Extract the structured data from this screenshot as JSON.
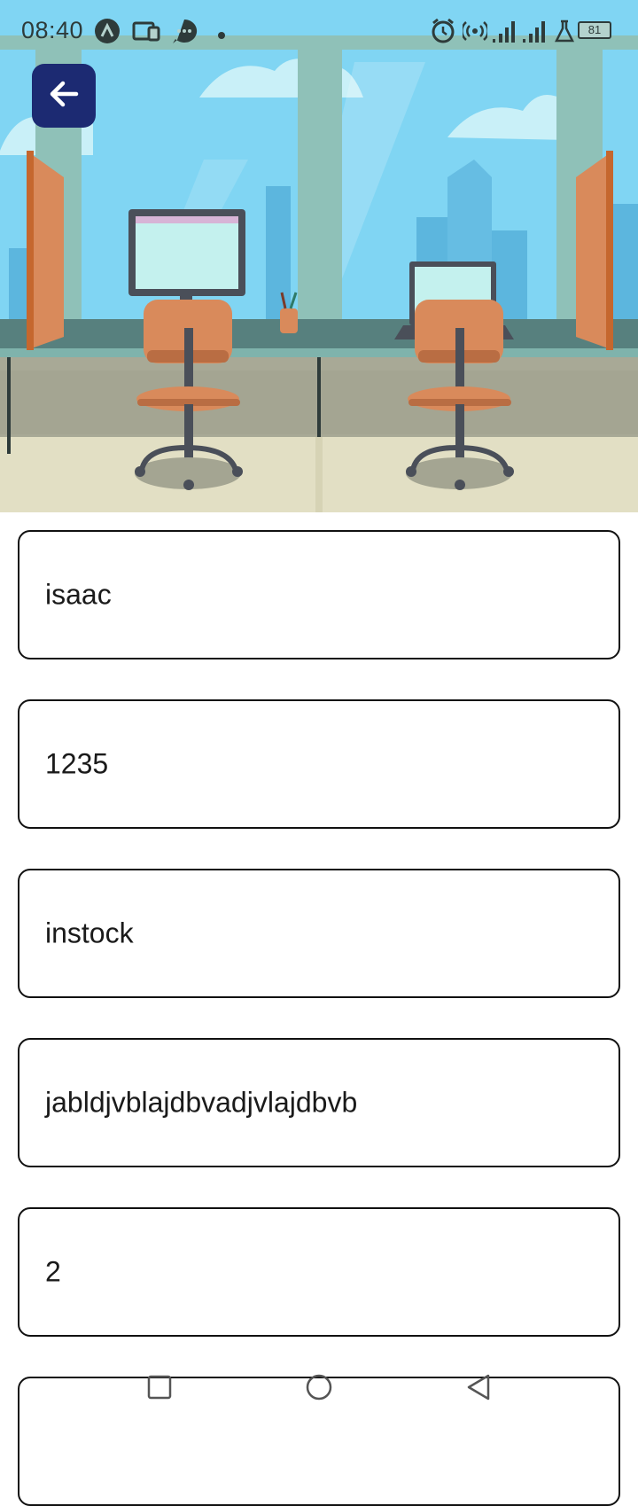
{
  "status_bar": {
    "time": "08:40",
    "battery": "81",
    "icons": [
      "a-app-icon",
      "cast-device-icon",
      "chat-bubble-icon",
      "dot-icon",
      "alarm-icon",
      "hotspot-icon",
      "signal-icon",
      "signal-icon",
      "lab-flask-icon",
      "battery-icon"
    ]
  },
  "header": {
    "back_icon": "arrow-left-icon",
    "illustration": "office-workspace-illustration"
  },
  "form": {
    "fields": [
      {
        "value": "isaac"
      },
      {
        "value": "1235"
      },
      {
        "value": "instock"
      },
      {
        "value": "jabldjvblajdbvadjvlajdbvb"
      },
      {
        "value": "2"
      },
      {
        "value": ""
      }
    ]
  },
  "nav_bar": {
    "icons": [
      "recents-square-icon",
      "home-circle-icon",
      "back-triangle-icon"
    ]
  },
  "colors": {
    "back_button": "#1c2a72",
    "field_border": "#111111",
    "sky": "#7fd4f2",
    "chair": "#d98a5b"
  }
}
